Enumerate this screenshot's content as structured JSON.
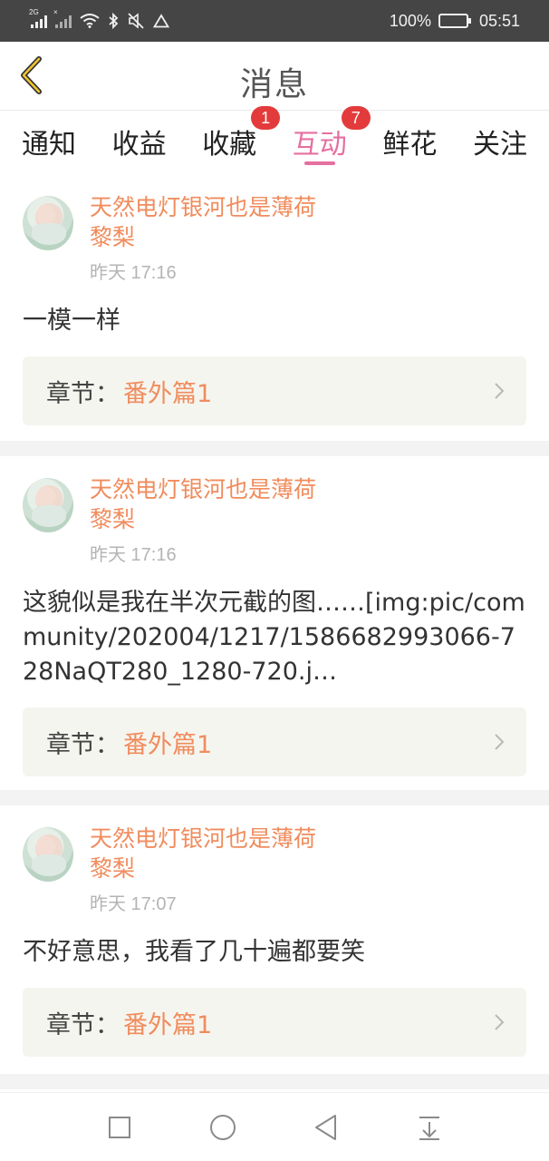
{
  "status_bar": {
    "network": "2G",
    "battery": "100%",
    "time": "05:51"
  },
  "header": {
    "title": "消息"
  },
  "tabs": [
    {
      "label": "通知",
      "badge": ""
    },
    {
      "label": "收益",
      "badge": ""
    },
    {
      "label": "收藏",
      "badge": "1"
    },
    {
      "label": "互动",
      "badge": "7",
      "active": true
    },
    {
      "label": "鲜花",
      "badge": ""
    },
    {
      "label": "关注",
      "badge": ""
    }
  ],
  "items": [
    {
      "name_line1": "天然电灯银河也是薄荷",
      "name_line2": "黎梨",
      "time": "昨天 17:16",
      "content": "一模一样",
      "chapter_label": "章节：",
      "chapter_value": "番外篇1"
    },
    {
      "name_line1": "天然电灯银河也是薄荷",
      "name_line2": "黎梨",
      "time": "昨天 17:16",
      "content": "这貌似是我在半次元截的图……[img:pic/community/202004/1217/1586682993066-728NaQT280_1280-720.j…",
      "chapter_label": "章节：",
      "chapter_value": "番外篇1"
    },
    {
      "name_line1": "天然电灯银河也是薄荷",
      "name_line2": "黎梨",
      "time": "昨天 17:07",
      "content": "不好意思，我看了几十遍都要笑",
      "chapter_label": "章节：",
      "chapter_value": "番外篇1"
    }
  ],
  "colors": {
    "accent": "#e56fa0",
    "name": "#f08c5d",
    "badge": "#e33b3b"
  }
}
